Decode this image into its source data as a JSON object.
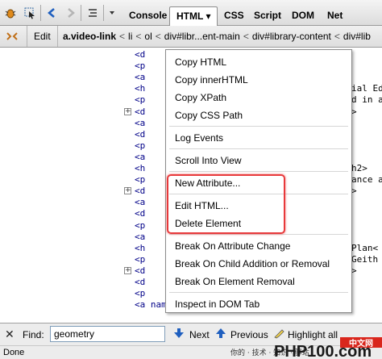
{
  "toolbar": {
    "tabs": [
      {
        "label": "Console"
      },
      {
        "label": "HTML ▾"
      },
      {
        "label": "CSS"
      },
      {
        "label": "Script"
      },
      {
        "label": "DOM"
      },
      {
        "label": "Net"
      }
    ]
  },
  "crumbbar": {
    "edit_label": "Edit",
    "crumbs": [
      "a.video-link",
      "li",
      "ol",
      "div#libr...ent-main",
      "div#library-content",
      "div#lib"
    ],
    "separator": "<"
  },
  "tree": {
    "rows": [
      {
        "left": "<d",
        "right": ""
      },
      {
        "left": "<p",
        "right": ""
      },
      {
        "left": "<a",
        "right": ""
      },
      {
        "left": "<h",
        "right": "ial Ed"
      },
      {
        "left": "<p",
        "right": "d in a"
      },
      {
        "left": "<d",
        "right": ">",
        "twisty": true
      },
      {
        "left": "<a",
        "right": ""
      },
      {
        "left": "<d",
        "right": ""
      },
      {
        "left": "<p",
        "right": ""
      },
      {
        "left": "<a",
        "right": ""
      },
      {
        "left": "<h",
        "right": "h2>"
      },
      {
        "left": "<p",
        "right": "ance a"
      },
      {
        "left": "<d",
        "right": ">",
        "twisty": true
      },
      {
        "left": "<a",
        "right": ""
      },
      {
        "left": "<d",
        "right": ""
      },
      {
        "left": "<p",
        "right": ""
      },
      {
        "left": "<a",
        "right": ""
      },
      {
        "left": "<h",
        "right": "Plan<"
      },
      {
        "left": "<p",
        "right": "Geith"
      },
      {
        "left": "<d",
        "right": ">",
        "twisty": true
      },
      {
        "left": "<d",
        "right": ""
      },
      {
        "left": "<p",
        "right": ""
      },
      {
        "left": "<a name=\"Geometry\"></a>",
        "right": ""
      }
    ]
  },
  "menu": {
    "items": [
      {
        "label": "Copy HTML"
      },
      {
        "label": "Copy innerHTML"
      },
      {
        "label": "Copy XPath"
      },
      {
        "label": "Copy CSS Path"
      },
      {
        "label": "Log Events"
      },
      {
        "label": "Scroll Into View"
      },
      {
        "label": "New Attribute..."
      },
      {
        "label": "Edit HTML..."
      },
      {
        "label": "Delete Element"
      },
      {
        "label": "Break On Attribute Change"
      },
      {
        "label": "Break On Child Addition or Removal"
      },
      {
        "label": "Break On Element Removal"
      },
      {
        "label": "Inspect in DOM Tab"
      }
    ],
    "highlight_color": "#e8393b"
  },
  "findbar": {
    "close_glyph": "✕",
    "find_label": "Find:",
    "find_value": "geometry",
    "next_label": "Next",
    "previous_label": "Previous",
    "highlight_label": "Highlight all"
  },
  "status": {
    "text": "Done"
  },
  "watermark": {
    "line1": "中文网",
    "brand": "PHP100.com",
    "tagline": "你的 · 技术 · 知识 · 驿站"
  },
  "colors": {
    "tag_blue": "#000088",
    "accent_blue": "#1f5fbf",
    "highlight_red": "#e8393b"
  }
}
